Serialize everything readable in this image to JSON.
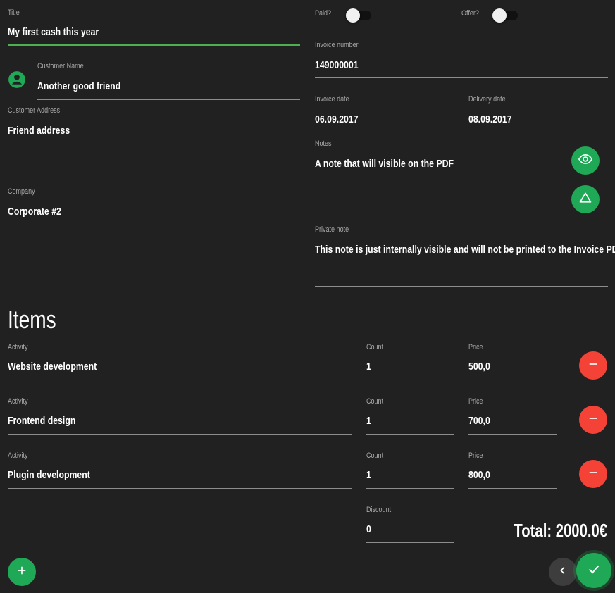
{
  "invoice": {
    "title_label": "Title",
    "title_value": "My first cash this year",
    "customer_name_label": "Customer Name",
    "customer_name_value": "Another good friend",
    "customer_address_label": "Customer Address",
    "customer_address_value": "Friend address",
    "company_label": "Company",
    "company_value": "Corporate #2",
    "paid_label": "Paid?",
    "offer_label": "Offer?",
    "invoice_number_label": "Invoice number",
    "invoice_number_value": "149000001",
    "invoice_date_label": "Invoice date",
    "invoice_date_value": "06.09.2017",
    "delivery_date_label": "Delivery date",
    "delivery_date_value": "08.09.2017",
    "notes_label": "Notes",
    "notes_value": "A note that will visible on the PDF",
    "private_note_label": "Private note",
    "private_note_value": "This note is just internally visible and will not be printed to the Invoice PDF"
  },
  "items": {
    "heading": "Items",
    "activity_label": "Activity",
    "count_label": "Count",
    "price_label": "Price",
    "rows": [
      {
        "activity": "Website development",
        "count": "1",
        "price": "500,0"
      },
      {
        "activity": "Frontend design",
        "count": "1",
        "price": "700,0"
      },
      {
        "activity": "Plugin development",
        "count": "1",
        "price": "800,0"
      }
    ],
    "discount_label": "Discount",
    "discount_value": "0",
    "total": "Total: 2000.0€"
  },
  "toggles": {
    "paid": false,
    "offer": false
  },
  "icons": {
    "avatar": "account-circle-icon",
    "preview": "eye-icon",
    "export": "triangle-icon",
    "remove": "minus-icon",
    "add": "plus-icon",
    "back": "chevron-left-icon",
    "save": "check-icon"
  },
  "colors": {
    "background": "#212121",
    "accent": "#1fa855",
    "active_underline": "#4caf50",
    "danger": "#f44336"
  }
}
